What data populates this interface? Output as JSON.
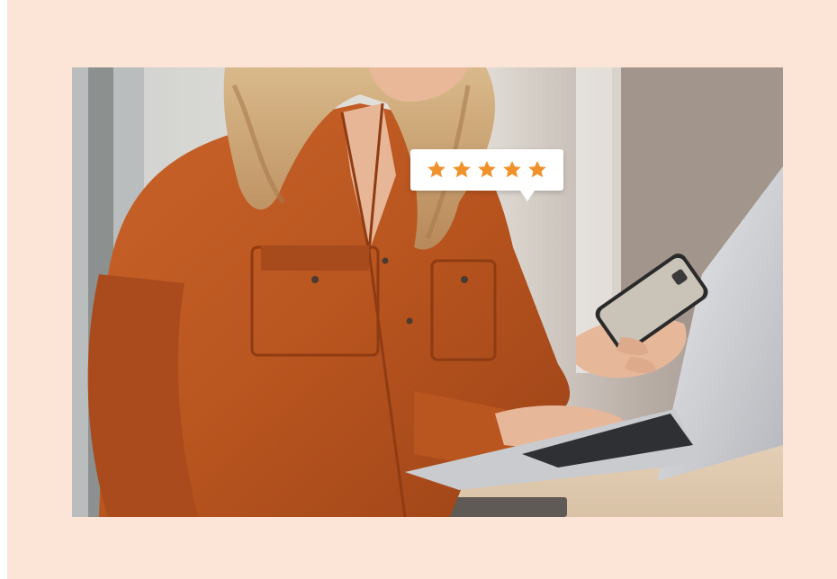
{
  "image": {
    "alt": "",
    "background_color": "#fce4d6"
  },
  "review": {
    "rating": 5,
    "max_rating": 5,
    "star_color": "#f0922c"
  }
}
